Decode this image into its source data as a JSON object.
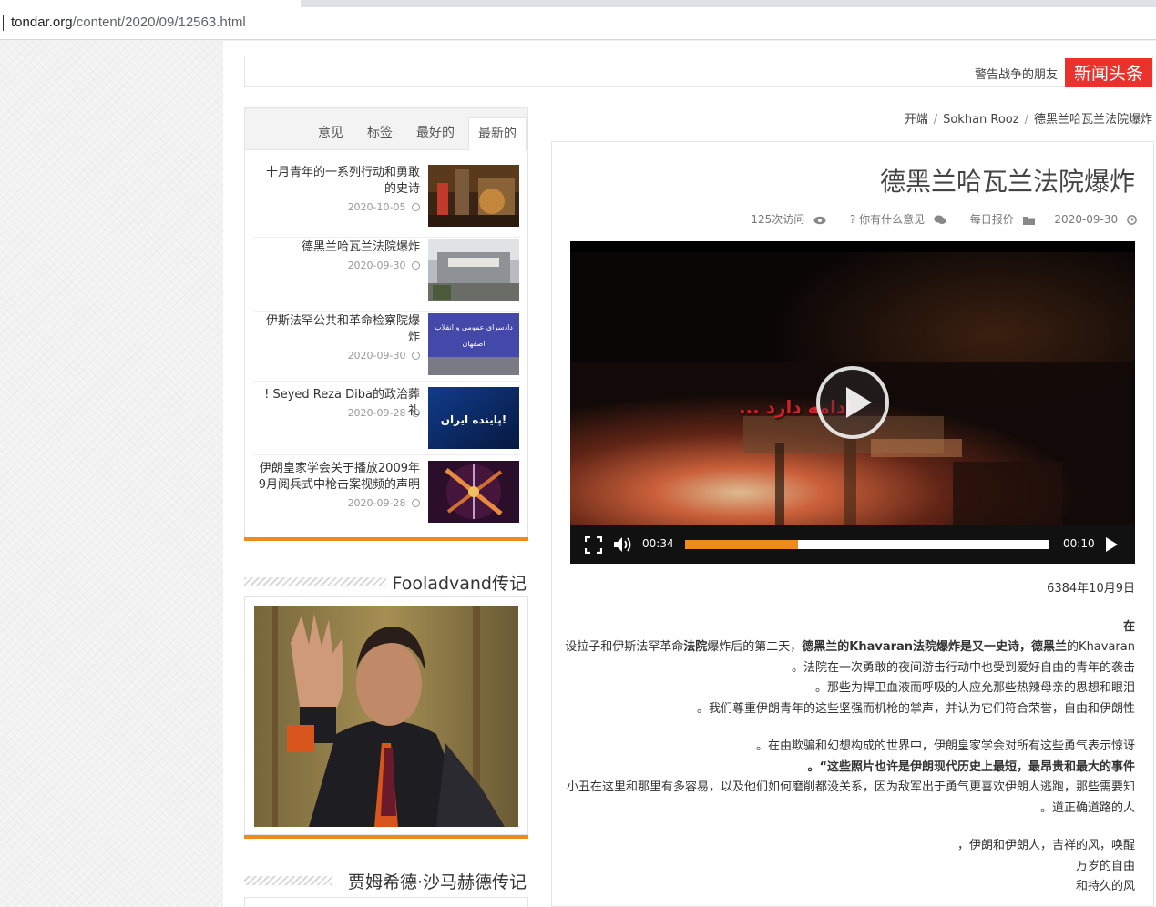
{
  "browser": {
    "url_host": "tondar.org",
    "url_path": "/content/2020/09/12563.html"
  },
  "ticker": {
    "badge": "新闻头条",
    "item": "警告战争的朋友"
  },
  "breadcrumb": [
    "开端",
    "Sokhan Rooz",
    "德黑兰哈瓦兰法院爆炸"
  ],
  "sidebar": {
    "tabs": [
      "意见",
      "标签",
      "最好的",
      "最新的"
    ],
    "active_tab": "最新的",
    "posts": [
      {
        "title": "十月青年的一系列行动和勇敢的史诗",
        "date": "2020-10-05"
      },
      {
        "title": "德黑兰哈瓦兰法院爆炸",
        "date": "2020-09-30"
      },
      {
        "title": "伊斯法罕公共和革命检察院爆炸",
        "date": "2020-09-30"
      },
      {
        "title": "! Seyed Reza Diba的政治葬礼",
        "date": "2020-09-28"
      },
      {
        "title": "伊朗皇家学会关于播放2009年9月阅兵式中枪击案视频的声明",
        "date": "2020-09-28"
      }
    ],
    "thumb_texts": {
      "post3": "دادسرای عمومی و انقلاب اصفهان",
      "post4": "پاینده ایران!"
    },
    "section1_title": "Fooladvand传记",
    "section2_title": "贾姆希德·沙马赫德传记"
  },
  "article": {
    "title": "德黑兰哈瓦兰法院爆炸",
    "meta": {
      "views": "125次访问",
      "comments": "? 你有什么意见",
      "category": "每日报价",
      "date": "2020-09-30"
    },
    "video": {
      "overlay_text": "ادامه دارد ...",
      "current_time": "00:34",
      "remaining_time": "00:10",
      "progress": 0.31
    },
    "date_line": "6384年10月9日",
    "lead": "在",
    "paragraph1": {
      "part1": "设拉子和伊斯法罕革命",
      "part2": "法院",
      "part3": "爆炸后的第二天，",
      "part4": "德黑兰的Khavaran法院爆炸是又一史诗，德黑兰",
      "part5": "的Khavaran法院在一次勇敢的夜间游击行动中也受到爱好自由的青年的袭击。"
    },
    "line3": "那些为捍卫血液而呼吸的人应允那些热辣母亲的思想和眼泪。",
    "line4": "我们尊重伊朗青年的这些坚强而机枪的掌声，并认为它们符合荣誉，自由和伊朗性。",
    "line5": "在由欺骗和幻想构成的世界中，伊朗皇家学会对所有这些勇气表示惊讶。",
    "line6": "这些照片也许是伊朗现代历史上最短，最昂贵和最大的事件“。",
    "line7": "小丑在这里和那里有多容易，以及他们如何磨削都没关系，因为敌军出于勇气更喜欢伊朗人逃跑，那些需要知道正确道路的人。",
    "line8": "伊朗和伊朗人，吉祥的风，唤醒，",
    "line9": "万岁的自由",
    "line10": "和持久的风"
  },
  "colors": {
    "accent_orange": "#ef8b1d",
    "badge_red": "#e8322b"
  }
}
